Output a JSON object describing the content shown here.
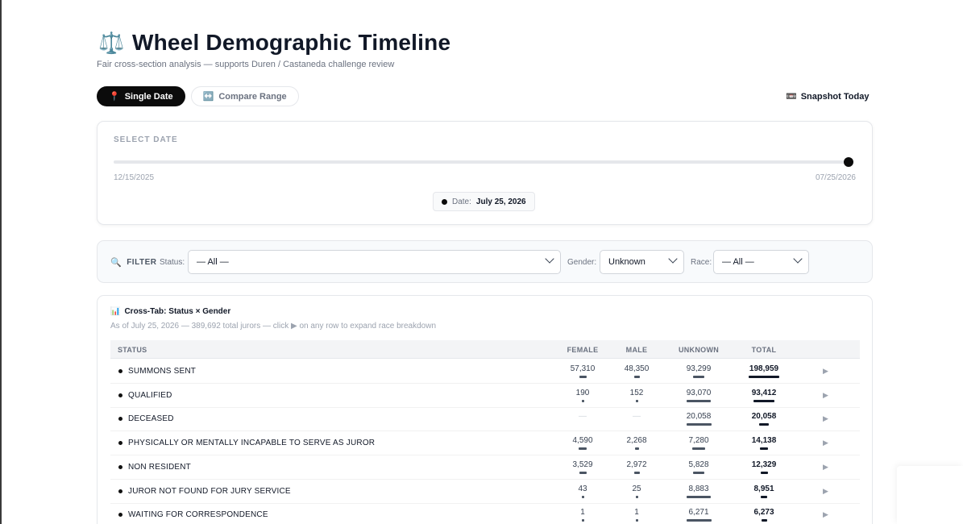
{
  "header": {
    "icon": "scales-icon",
    "icon_glyph": "⚖️",
    "title": "Wheel Demographic Timeline",
    "subtitle": "Fair cross-section analysis — supports Duren / Castaneda challenge review"
  },
  "modes": {
    "single": {
      "icon": "📍",
      "label": "Single Date"
    },
    "compare": {
      "icon": "↔️",
      "label": "Compare Range"
    }
  },
  "snapshot": {
    "icon": "📼",
    "label": "Snapshot Today"
  },
  "date_picker": {
    "label": "SELECT DATE",
    "start": "12/15/2025",
    "end": "07/25/2026",
    "value_label": "Date:",
    "value": "July 25, 2026",
    "position_fraction": 1.0
  },
  "filter": {
    "icon": "🔍",
    "label": "FILTER",
    "status_label": "Status:",
    "status_value": "— All —",
    "gender_label": "Gender:",
    "gender_value": "Unknown",
    "race_label": "Race:",
    "race_value": "— All —"
  },
  "crosstab": {
    "icon": "📊",
    "title": "Cross-Tab: Status × Gender",
    "subtitle": "As of July 25, 2026 — 389,692 total jurors — click ▶ on any row to expand race breakdown",
    "columns": {
      "status": "STATUS",
      "female": "FEMALE",
      "male": "MALE",
      "unknown": "UNKNOWN",
      "total": "TOTAL"
    },
    "expand_glyph": "▶",
    "rows": [
      {
        "status": "SUMMONS SENT",
        "female": "57,310",
        "male": "48,350",
        "unknown": "93,299",
        "total": "198,959",
        "f": 57310,
        "m": 48350,
        "u": 93299,
        "t": 198959
      },
      {
        "status": "QUALIFIED",
        "female": "190",
        "male": "152",
        "unknown": "93,070",
        "total": "93,412",
        "f": 190,
        "m": 152,
        "u": 93070,
        "t": 93412
      },
      {
        "status": "DECEASED",
        "female": "—",
        "male": "—",
        "unknown": "20,058",
        "total": "20,058",
        "f": 0,
        "m": 0,
        "u": 20058,
        "t": 20058
      },
      {
        "status": "PHYSICALLY OR MENTALLY INCAPABLE TO SERVE AS JUROR",
        "female": "4,590",
        "male": "2,268",
        "unknown": "7,280",
        "total": "14,138",
        "f": 4590,
        "m": 2268,
        "u": 7280,
        "t": 14138
      },
      {
        "status": "NON RESIDENT",
        "female": "3,529",
        "male": "2,972",
        "unknown": "5,828",
        "total": "12,329",
        "f": 3529,
        "m": 2972,
        "u": 5828,
        "t": 12329
      },
      {
        "status": "JUROR NOT FOUND FOR JURY SERVICE",
        "female": "43",
        "male": "25",
        "unknown": "8,883",
        "total": "8,951",
        "f": 43,
        "m": 25,
        "u": 8883,
        "t": 8951
      },
      {
        "status": "WAITING FOR CORRESPONDENCE",
        "female": "1",
        "male": "1",
        "unknown": "6,271",
        "total": "6,273",
        "f": 1,
        "m": 1,
        "u": 6271,
        "t": 6273
      }
    ]
  }
}
